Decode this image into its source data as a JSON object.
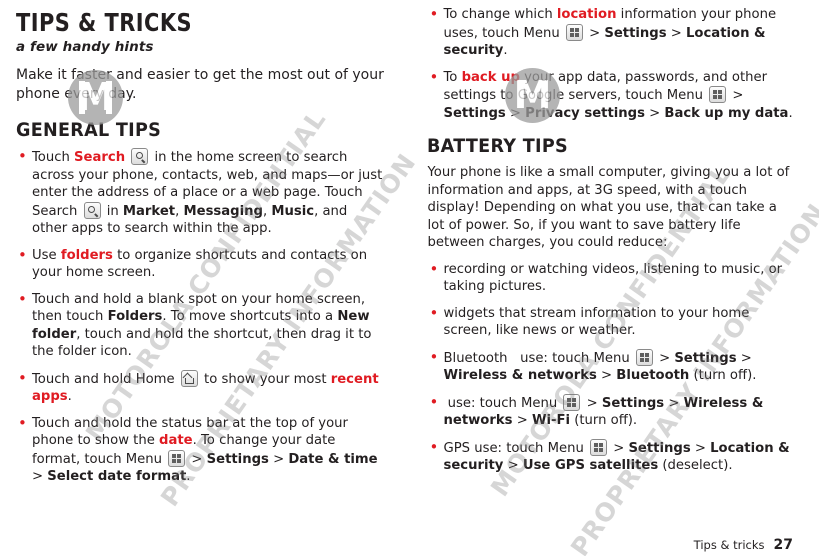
{
  "document": {
    "title": "TIPS & TRICKS",
    "subtitle": "a few handy hints",
    "intro": "Make it faster and easier to get the most out of your phone every day.",
    "footer_text": "Tips & tricks",
    "page_number": "27"
  },
  "general_tips": {
    "heading": "GENERAL TIPS",
    "items": [
      {
        "segments": [
          {
            "t": "Touch ",
            "s": "plain"
          },
          {
            "t": "Search",
            "s": "red"
          },
          {
            "t": " ",
            "s": "plain"
          },
          {
            "t": "search-icon",
            "s": "icon-search"
          },
          {
            "t": " in the home screen to search across your phone, contacts, web, and maps—or just enter the address of a place or a web page. Touch Search ",
            "s": "plain"
          },
          {
            "t": "search-icon",
            "s": "icon-search"
          },
          {
            "t": " in ",
            "s": "plain"
          },
          {
            "t": "Market",
            "s": "bold"
          },
          {
            "t": ", ",
            "s": "plain"
          },
          {
            "t": "Messaging",
            "s": "bold"
          },
          {
            "t": ", ",
            "s": "plain"
          },
          {
            "t": "Music",
            "s": "bold"
          },
          {
            "t": ", and other apps to search within the app.",
            "s": "plain"
          }
        ]
      },
      {
        "segments": [
          {
            "t": "Use ",
            "s": "plain"
          },
          {
            "t": "folders",
            "s": "red"
          },
          {
            "t": " to organize shortcuts and contacts on your home screen.",
            "s": "plain"
          }
        ]
      },
      {
        "nobullet": true,
        "segments": [
          {
            "t": "Touch and hold a blank spot on your home screen, then touch ",
            "s": "plain"
          },
          {
            "t": "Folders",
            "s": "bold"
          },
          {
            "t": ". To move shortcuts into a ",
            "s": "plain"
          },
          {
            "t": "New folder",
            "s": "bold"
          },
          {
            "t": ", touch and hold the shortcut, then drag it to the folder icon.",
            "s": "plain"
          }
        ]
      },
      {
        "segments": [
          {
            "t": "Touch and hold Home ",
            "s": "plain"
          },
          {
            "t": "home-icon",
            "s": "icon-home"
          },
          {
            "t": " to show your most ",
            "s": "plain"
          },
          {
            "t": "recent apps",
            "s": "red"
          },
          {
            "t": ".",
            "s": "plain"
          }
        ]
      },
      {
        "segments": [
          {
            "t": "Touch and hold the status bar at the top of your phone to show the ",
            "s": "plain"
          },
          {
            "t": "date",
            "s": "red"
          },
          {
            "t": ". To change your date format, touch Menu ",
            "s": "plain"
          },
          {
            "t": "menu-icon",
            "s": "icon-menu"
          },
          {
            "t": " > ",
            "s": "plain"
          },
          {
            "t": "Settings",
            "s": "bold"
          },
          {
            "t": " > ",
            "s": "plain"
          },
          {
            "t": "Date & time",
            "s": "bold"
          },
          {
            "t": " > ",
            "s": "plain"
          },
          {
            "t": "Select date format",
            "s": "bold"
          },
          {
            "t": ".",
            "s": "plain"
          }
        ]
      }
    ]
  },
  "right_tips": {
    "items": [
      {
        "segments": [
          {
            "t": "To change which ",
            "s": "plain"
          },
          {
            "t": "location",
            "s": "red"
          },
          {
            "t": " information your phone uses, touch Menu ",
            "s": "plain"
          },
          {
            "t": "menu-icon",
            "s": "icon-menu"
          },
          {
            "t": " > ",
            "s": "plain"
          },
          {
            "t": "Settings",
            "s": "bold"
          },
          {
            "t": " > ",
            "s": "plain"
          },
          {
            "t": "Location & security",
            "s": "bold"
          },
          {
            "t": ".",
            "s": "plain"
          }
        ]
      },
      {
        "segments": [
          {
            "t": "To ",
            "s": "plain"
          },
          {
            "t": "back up",
            "s": "red"
          },
          {
            "t": " your app data, passwords, and other settings to Google servers, touch Menu ",
            "s": "plain"
          },
          {
            "t": "menu-icon",
            "s": "icon-menu"
          },
          {
            "t": " > ",
            "s": "plain"
          },
          {
            "t": "Settings",
            "s": "bold"
          },
          {
            "t": " > ",
            "s": "plain"
          },
          {
            "t": "Privacy settings",
            "s": "bold"
          },
          {
            "t": " > ",
            "s": "plain"
          },
          {
            "t": "Back up my data",
            "s": "bold"
          },
          {
            "t": ".",
            "s": "plain"
          }
        ]
      }
    ]
  },
  "battery_tips": {
    "heading": "BATTERY TIPS",
    "intro": "Your phone is like a small computer, giving you a lot of information and apps, at 3G speed, with a touch display! Depending on what you use, that can take a lot of power. So, if you want to save battery life between charges, you could reduce:",
    "items": [
      {
        "segments": [
          {
            "t": "recording or watching videos, listening to music, or taking pictures.",
            "s": "plain"
          }
        ]
      },
      {
        "segments": [
          {
            "t": "widgets that stream information to your home screen, like news or weather.",
            "s": "plain"
          }
        ]
      },
      {
        "segments": [
          {
            "t": "Bluetooth",
            "s": "plain"
          },
          {
            "t": "   use: touch Menu ",
            "s": "plain"
          },
          {
            "t": "menu-icon",
            "s": "icon-menu"
          },
          {
            "t": " > ",
            "s": "plain"
          },
          {
            "t": "Settings",
            "s": "bold"
          },
          {
            "t": " > ",
            "s": "plain"
          },
          {
            "t": "Wireless & networks",
            "s": "bold"
          },
          {
            "t": " > ",
            "s": "plain"
          },
          {
            "t": "Bluetooth",
            "s": "bold"
          },
          {
            "t": " (turn off).",
            "s": "plain"
          }
        ]
      },
      {
        "segments": [
          {
            "t": " use: touch Menu ",
            "s": "plain"
          },
          {
            "t": "menu-icon",
            "s": "icon-menu"
          },
          {
            "t": " > ",
            "s": "plain"
          },
          {
            "t": "Settings",
            "s": "bold"
          },
          {
            "t": " > ",
            "s": "plain"
          },
          {
            "t": "Wireless & networks",
            "s": "bold"
          },
          {
            "t": " > ",
            "s": "plain"
          },
          {
            "t": "Wi-Fi",
            "s": "bold"
          },
          {
            "t": " (turn off).",
            "s": "plain"
          }
        ]
      },
      {
        "segments": [
          {
            "t": "GPS use: touch Menu ",
            "s": "plain"
          },
          {
            "t": "menu-icon",
            "s": "icon-menu"
          },
          {
            "t": " > ",
            "s": "plain"
          },
          {
            "t": "Settings",
            "s": "bold"
          },
          {
            "t": " > ",
            "s": "plain"
          },
          {
            "t": "Location & security",
            "s": "bold"
          },
          {
            "t": " > ",
            "s": "plain"
          },
          {
            "t": "Use GPS satellites",
            "s": "bold"
          },
          {
            "t": " (deselect).",
            "s": "plain"
          }
        ]
      }
    ]
  },
  "watermark": {
    "lines": [
      "MOTOROLA CONFIDENTIAL",
      "PROPRIETARY INFORMATION",
      "MOTOROLA CONFIDENTIAL",
      "PROPRIETARY INFORMATION"
    ],
    "logo_letter": "M"
  },
  "colors": {
    "accent_red": "#e01b22",
    "text": "#231f20",
    "watermark": "#787878"
  }
}
